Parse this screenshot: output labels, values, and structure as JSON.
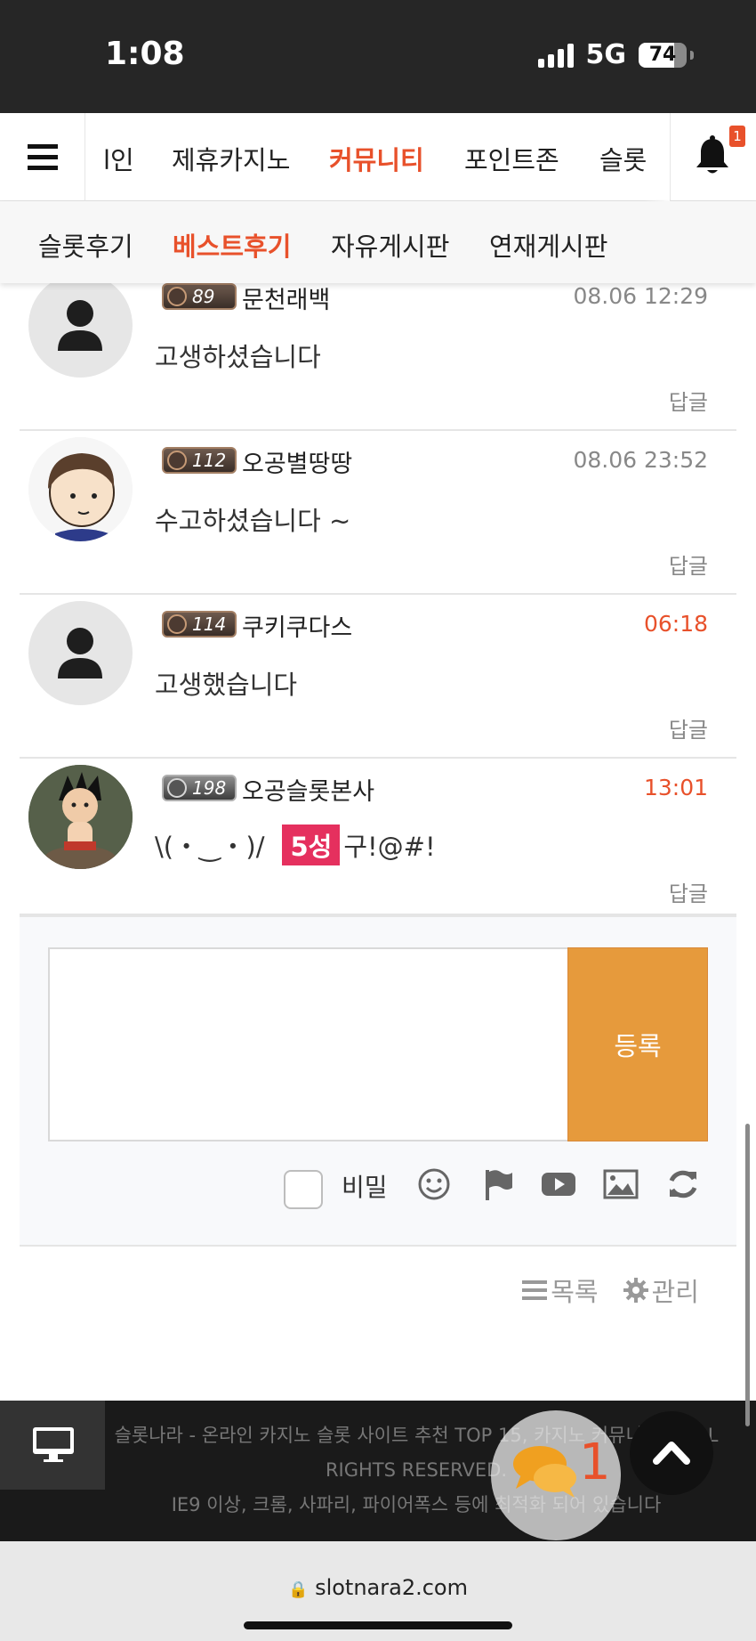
{
  "status_bar": {
    "time": "1:08",
    "network": "5G",
    "battery": "74"
  },
  "main_nav": {
    "items": [
      {
        "label": "l인"
      },
      {
        "label": "제휴카지노"
      },
      {
        "label": "커뮤니티"
      },
      {
        "label": "포인트존"
      },
      {
        "label": "슬롯"
      }
    ],
    "notification_count": "1"
  },
  "sub_nav": {
    "items": [
      {
        "label": "슬롯후기"
      },
      {
        "label": "베스트후기"
      },
      {
        "label": "자유게시판"
      },
      {
        "label": "연재게시판"
      }
    ]
  },
  "comments": [
    {
      "level": "89",
      "nickname": "문천래백",
      "time": "08.06 12:29",
      "text": "고생하셨습니다",
      "reply": "답글"
    },
    {
      "level": "112",
      "nickname": "오공별땅땅",
      "time": "08.06 23:52",
      "text": "수고하셨습니다 ~",
      "reply": "답글"
    },
    {
      "level": "114",
      "nickname": "쿠키쿠다스",
      "time": "06:18",
      "text": "고생했습니다",
      "reply": "답글"
    },
    {
      "level": "198",
      "nickname": "오공슬롯본사",
      "time": "13:01",
      "text_prefix": "\\(・‿・)/",
      "text_tag": "5성",
      "text_suffix": "구!@#!",
      "reply": "답글"
    }
  ],
  "comment_form": {
    "submit_label": "등록",
    "secret_label": "비밀"
  },
  "bottom_links": {
    "list_label": "목록",
    "manage_label": "관리"
  },
  "footer": {
    "copyright": "슬롯나라 - 온라인 카지노 슬롯 사이트 추천 TOP 15, 카지노 커뮤니티 ©ALL RIGHTS RESERVED.",
    "browser_note": "IE9 이상, 크롬, 사파리, 파이어폭스 등에 최적화 되어 있습니다",
    "chat_count": "1"
  },
  "url_bar": {
    "domain": "slotnara2.com"
  },
  "colors": {
    "accent": "#e8512b",
    "submit": "#e69a3c",
    "tag": "#e5305e"
  }
}
